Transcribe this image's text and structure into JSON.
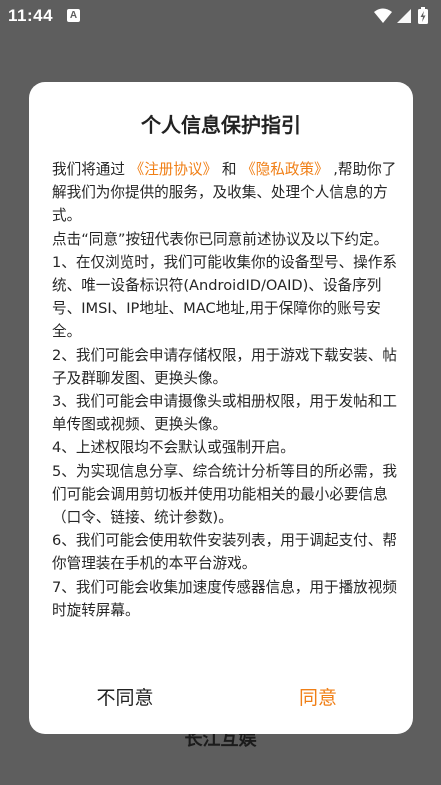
{
  "status_bar": {
    "time": "11:44",
    "notification_icon": "a-letter-icon",
    "icons": [
      "wifi-icon",
      "cellular-signal-icon",
      "battery-charging-icon"
    ]
  },
  "background": {
    "partial_text": "长江互娱"
  },
  "dialog": {
    "title": "个人信息保护指引",
    "intro": {
      "prefix": "我们将通过 ",
      "link1": "《注册协议》",
      "and": " 和 ",
      "link2": "《隐私政策》",
      "suffix": " ,帮助你了解我们为你提供的服务，及收集、处理个人信息的方式。"
    },
    "paragraphs": [
      "点击“同意”按钮代表你已同意前述协议及以下约定。",
      "1、在仅浏览时，我们可能收集你的设备型号、操作系统、唯一设备标识符(AndroidID/OAID)、设备序列号、IMSI、IP地址、MAC地址,用于保障你的账号安全。",
      "2、我们可能会申请存储权限，用于游戏下载安装、帖子及群聊发图、更换头像。",
      "3、我们可能会申请摄像头或相册权限，用于发帖和工单传图或视频、更换头像。",
      "4、上述权限均不会默认或强制开启。",
      "5、为实现信息分享、综合统计分析等目的所必需，我们可能会调用剪切板并使用功能相关的最小必要信息（口令、链接、统计参数)。",
      "6、我们可能会使用软件安装列表，用于调起支付、帮你管理装在手机的本平台游戏。",
      "7、我们可能会收集加速度传感器信息，用于播放视频时旋转屏幕。"
    ],
    "disagree_label": "不同意",
    "agree_label": "同意"
  },
  "colors": {
    "accent": "#f07f16",
    "overlay": "#5e5e5e",
    "dialog_bg": "#ffffff",
    "text": "#262626"
  }
}
